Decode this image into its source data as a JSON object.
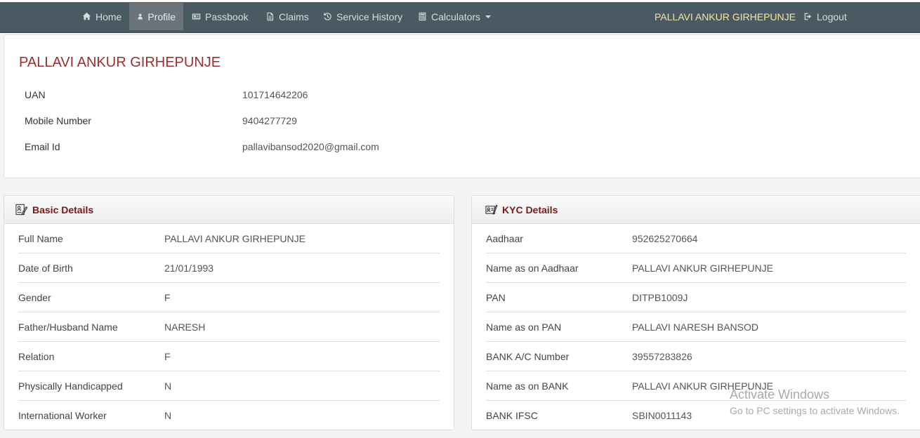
{
  "nav": {
    "items": [
      {
        "label": "Home",
        "icon": "home-icon"
      },
      {
        "label": "Profile",
        "icon": "user-icon"
      },
      {
        "label": "Passbook",
        "icon": "passbook-icon"
      },
      {
        "label": "Claims",
        "icon": "document-icon"
      },
      {
        "label": "Service History",
        "icon": "history-icon"
      },
      {
        "label": "Calculators",
        "icon": "calculator-icon"
      }
    ],
    "user_name": "PALLAVI ANKUR GIRHEPUNJE",
    "logout_label": "Logout",
    "colors": {
      "bar": "#4a5a62",
      "active": "#6a747a",
      "user": "#f4e5a8"
    }
  },
  "profile": {
    "name": "PALLAVI ANKUR GIRHEPUNJE",
    "fields": [
      {
        "label": "UAN",
        "value": "101714642206"
      },
      {
        "label": "Mobile Number",
        "value": "9404277729"
      },
      {
        "label": "Email Id",
        "value": "pallavibansod2020@gmail.com"
      }
    ]
  },
  "basic_details": {
    "title": "Basic Details",
    "rows": [
      {
        "label": "Full Name",
        "value": "PALLAVI ANKUR GIRHEPUNJE"
      },
      {
        "label": "Date of Birth",
        "value": "21/01/1993"
      },
      {
        "label": "Gender",
        "value": "F"
      },
      {
        "label": "Father/Husband Name",
        "value": "NARESH"
      },
      {
        "label": "Relation",
        "value": "F"
      },
      {
        "label": "Physically Handicapped",
        "value": "N"
      },
      {
        "label": "International Worker",
        "value": "N"
      }
    ]
  },
  "kyc_details": {
    "title": "KYC Details",
    "rows": [
      {
        "label": "Aadhaar",
        "value": "952625270664"
      },
      {
        "label": "Name as on Aadhaar",
        "value": "PALLAVI ANKUR GIRHEPUNJE"
      },
      {
        "label": "PAN",
        "value": "DITPB1009J"
      },
      {
        "label": "Name as on PAN",
        "value": "PALLAVI NARESH BANSOD"
      },
      {
        "label": "BANK A/C Number",
        "value": "39557283826"
      },
      {
        "label": "Name as on BANK",
        "value": "PALLAVI ANKUR GIRHEPUNJE"
      },
      {
        "label": "BANK IFSC",
        "value": "SBIN0011143"
      }
    ]
  },
  "watermark": {
    "line1": "Activate Windows",
    "line2": "Go to PC settings to activate Windows."
  }
}
